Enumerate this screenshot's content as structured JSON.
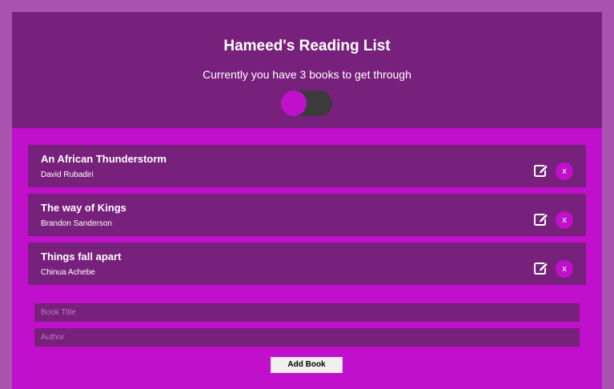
{
  "header": {
    "title": "Hameed's Reading List",
    "subtitle": "Currently you have 3 books to get through",
    "toggle_on": true
  },
  "books": [
    {
      "title": "An African Thunderstorm",
      "author": "David Rubadiri",
      "edit_icon": "edit-icon",
      "delete_label": "x"
    },
    {
      "title": "The way of Kings",
      "author": "Brandon Sanderson",
      "edit_icon": "edit-icon",
      "delete_label": "x"
    },
    {
      "title": "Things fall apart",
      "author": "Chinua Achebe",
      "edit_icon": "edit-icon",
      "delete_label": "x"
    }
  ],
  "form": {
    "title_placeholder": "Book Title",
    "title_value": "",
    "author_placeholder": "Author",
    "author_value": "",
    "submit_label": "Add Book"
  },
  "colors": {
    "page_border": "#a853ad",
    "app_background": "#c010cc",
    "panel": "#77207c",
    "toggle_track": "#3b3b3b",
    "accent": "#c010cc",
    "text": "#ffffff"
  }
}
